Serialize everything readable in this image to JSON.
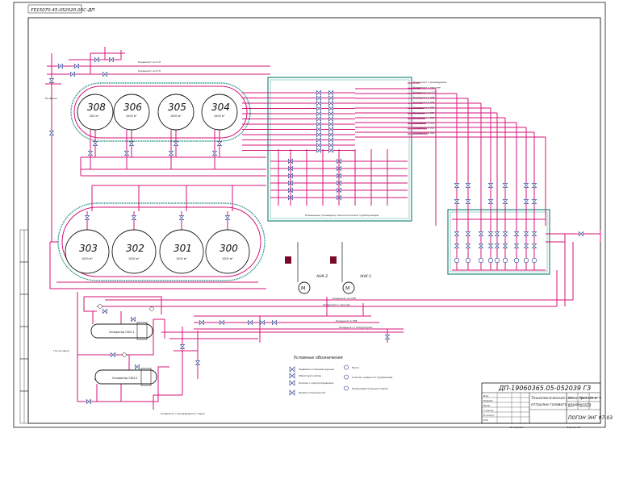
{
  "sheet": {
    "code_box": "ҒЕ15070.45-052020.05С-ДП",
    "tanks_upper": [
      {
        "num": "308",
        "vol": "400 м³"
      },
      {
        "num": "306",
        "vol": "1000 м³"
      },
      {
        "num": "305",
        "vol": "1000 м³"
      },
      {
        "num": "304",
        "vol": "1000 м³"
      }
    ],
    "tanks_lower": [
      {
        "num": "303",
        "vol": "1000 м³"
      },
      {
        "num": "302",
        "vol": "1000 м³"
      },
      {
        "num": "301",
        "vol": "1000 м³"
      },
      {
        "num": "300",
        "vol": "1000 м³"
      }
    ],
    "pumps": [
      {
        "label": "АНК-2"
      },
      {
        "label": "АНК-1"
      }
    ],
    "separators": [
      {
        "label": "Сепаратор С8/3-1"
      },
      {
        "label": "Сепаратор С8/3-2"
      }
    ],
    "line_labels": {
      "k_top1": "Конденсат из Н-П",
      "k_top2": "Конденсат из Н-П",
      "to_flare": "На факел",
      "from_ulp": "Газ на свечу",
      "k_bottom": "Конденсат с резервуарного парка",
      "manifold": "Помещение (площадка) технологических трубопроводов"
    },
    "manifold_lines": [
      "Конденсат к резервуарам",
      "Конденсат к насосам",
      "Конденсат из Н-П",
      "Конденсат в 308",
      "Конденсат в 306",
      "Конденсат в 305",
      "Конденсат в 304",
      "Конденсат в 303",
      "Конденсат в 302",
      "Конденсат в 301",
      "Конденсат в 300"
    ],
    "horizontal_runs": [
      "Конденсат к насосам",
      "Конденсат на АНК",
      "Конденсат в 308",
      "Конденсат к сепараторам"
    ],
    "legend": {
      "title": "Условные обозначения",
      "items": [
        "Задвижка клиновая ручная",
        "Обратный клапан",
        "Клапан с электроприводом",
        "Прибор технический",
        "Насос",
        "Счетчик жидкости (турбинный)",
        "Предохранительный клапан"
      ]
    },
    "title_block": {
      "doc_code": "ДП-19060365.05-052039 ГЗ",
      "title_line1": "Технологическая схема приема и",
      "title_line2": "отгрузки газового конденсата",
      "org": "ПОГОН ЭНГ 07-03",
      "stage_h": "Лит.",
      "mass_h": "Масса",
      "scale_h": "Масштаб",
      "sheet_h": "Лист",
      "sheets_h": "Листов 1",
      "role_rows": [
        "Изм.",
        "Разраб.",
        "Пров.",
        "Т.контр.",
        "Н.контр.",
        "Утв."
      ],
      "copied": "Копировал",
      "format": "Формат А1"
    },
    "colors": {
      "pipe": "#d6157a",
      "frame": "#1a1a1a",
      "enclosure": "#1f8a7a",
      "valve": "#2a3a8c",
      "equipment": "#7a0a2a"
    }
  }
}
